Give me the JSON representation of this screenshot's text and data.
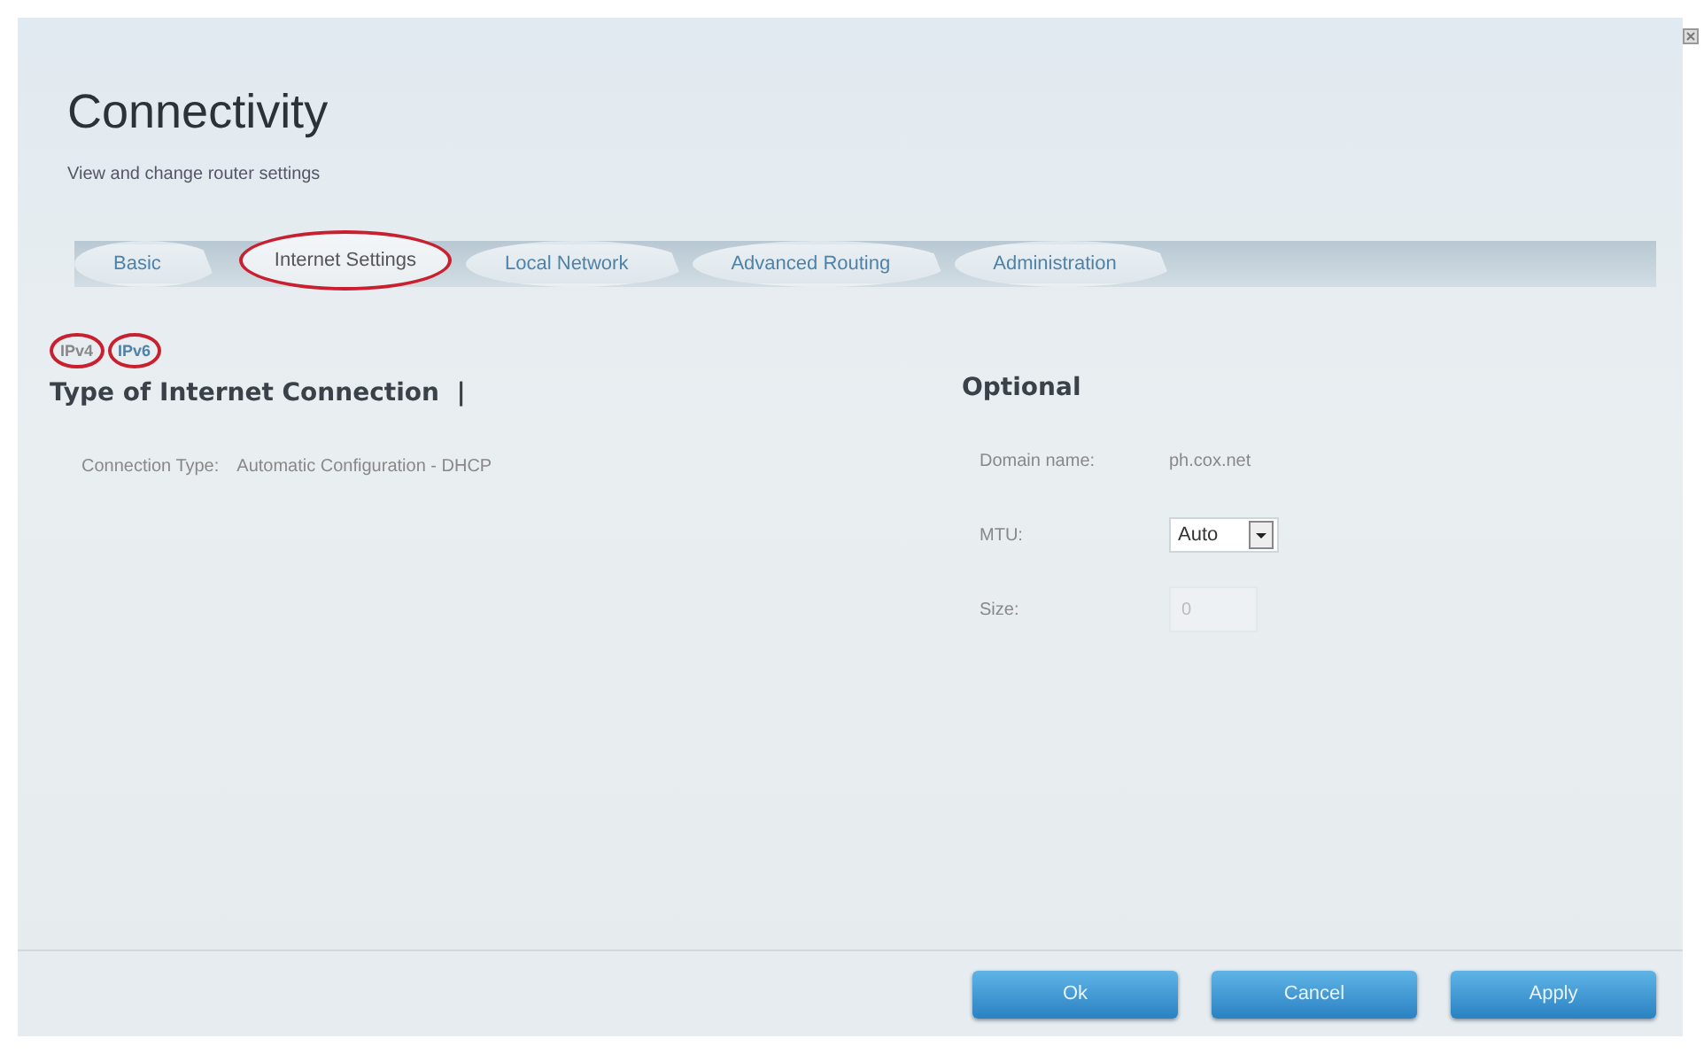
{
  "window": {
    "title": "Connectivity",
    "subtitle": "View and change router settings"
  },
  "tabs": [
    {
      "label": "Basic",
      "selected": false,
      "circled": false
    },
    {
      "label": "Internet Settings",
      "selected": true,
      "circled": true
    },
    {
      "label": "Local Network",
      "selected": false,
      "circled": false
    },
    {
      "label": "Advanced Routing",
      "selected": false,
      "circled": false
    },
    {
      "label": "Administration",
      "selected": false,
      "circled": false
    }
  ],
  "ip_versions": [
    {
      "label": "IPv4",
      "selected": true,
      "circled": true
    },
    {
      "label": "IPv6",
      "selected": false,
      "circled": true
    }
  ],
  "left_section": {
    "heading": "Type of Internet Connection  |",
    "fields": [
      {
        "label": "Connection Type:",
        "value": "Automatic Configuration - DHCP"
      }
    ]
  },
  "right_section": {
    "heading": "Optional",
    "fields": [
      {
        "kind": "text",
        "label": "Domain name:",
        "value": "ph.cox.net"
      },
      {
        "kind": "select",
        "label": "MTU:",
        "value": "Auto"
      },
      {
        "kind": "input",
        "label": "Size:",
        "value": "0",
        "disabled": true
      }
    ]
  },
  "buttons": [
    "Ok",
    "Cancel",
    "Apply"
  ]
}
